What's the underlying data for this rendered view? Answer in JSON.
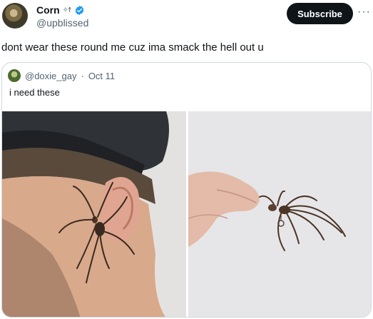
{
  "tweet": {
    "display_name": "Corn",
    "name_emoji": "✧︎☨",
    "handle": "@upblissed",
    "subscribe_label": "Subscribe",
    "more_label": "···",
    "text": "dont wear these round me cuz ima smack the hell out u"
  },
  "quote": {
    "handle": "@doxie_gay",
    "separator": "·",
    "date": "Oct 11",
    "text": "i need these"
  },
  "colors": {
    "verified": "#1d9bf0",
    "subscribe_bg": "#0f1419",
    "secondary_text": "#536471",
    "border": "#cfd9de"
  },
  "icons": [
    "verified-badge-icon",
    "more-options-icon"
  ]
}
